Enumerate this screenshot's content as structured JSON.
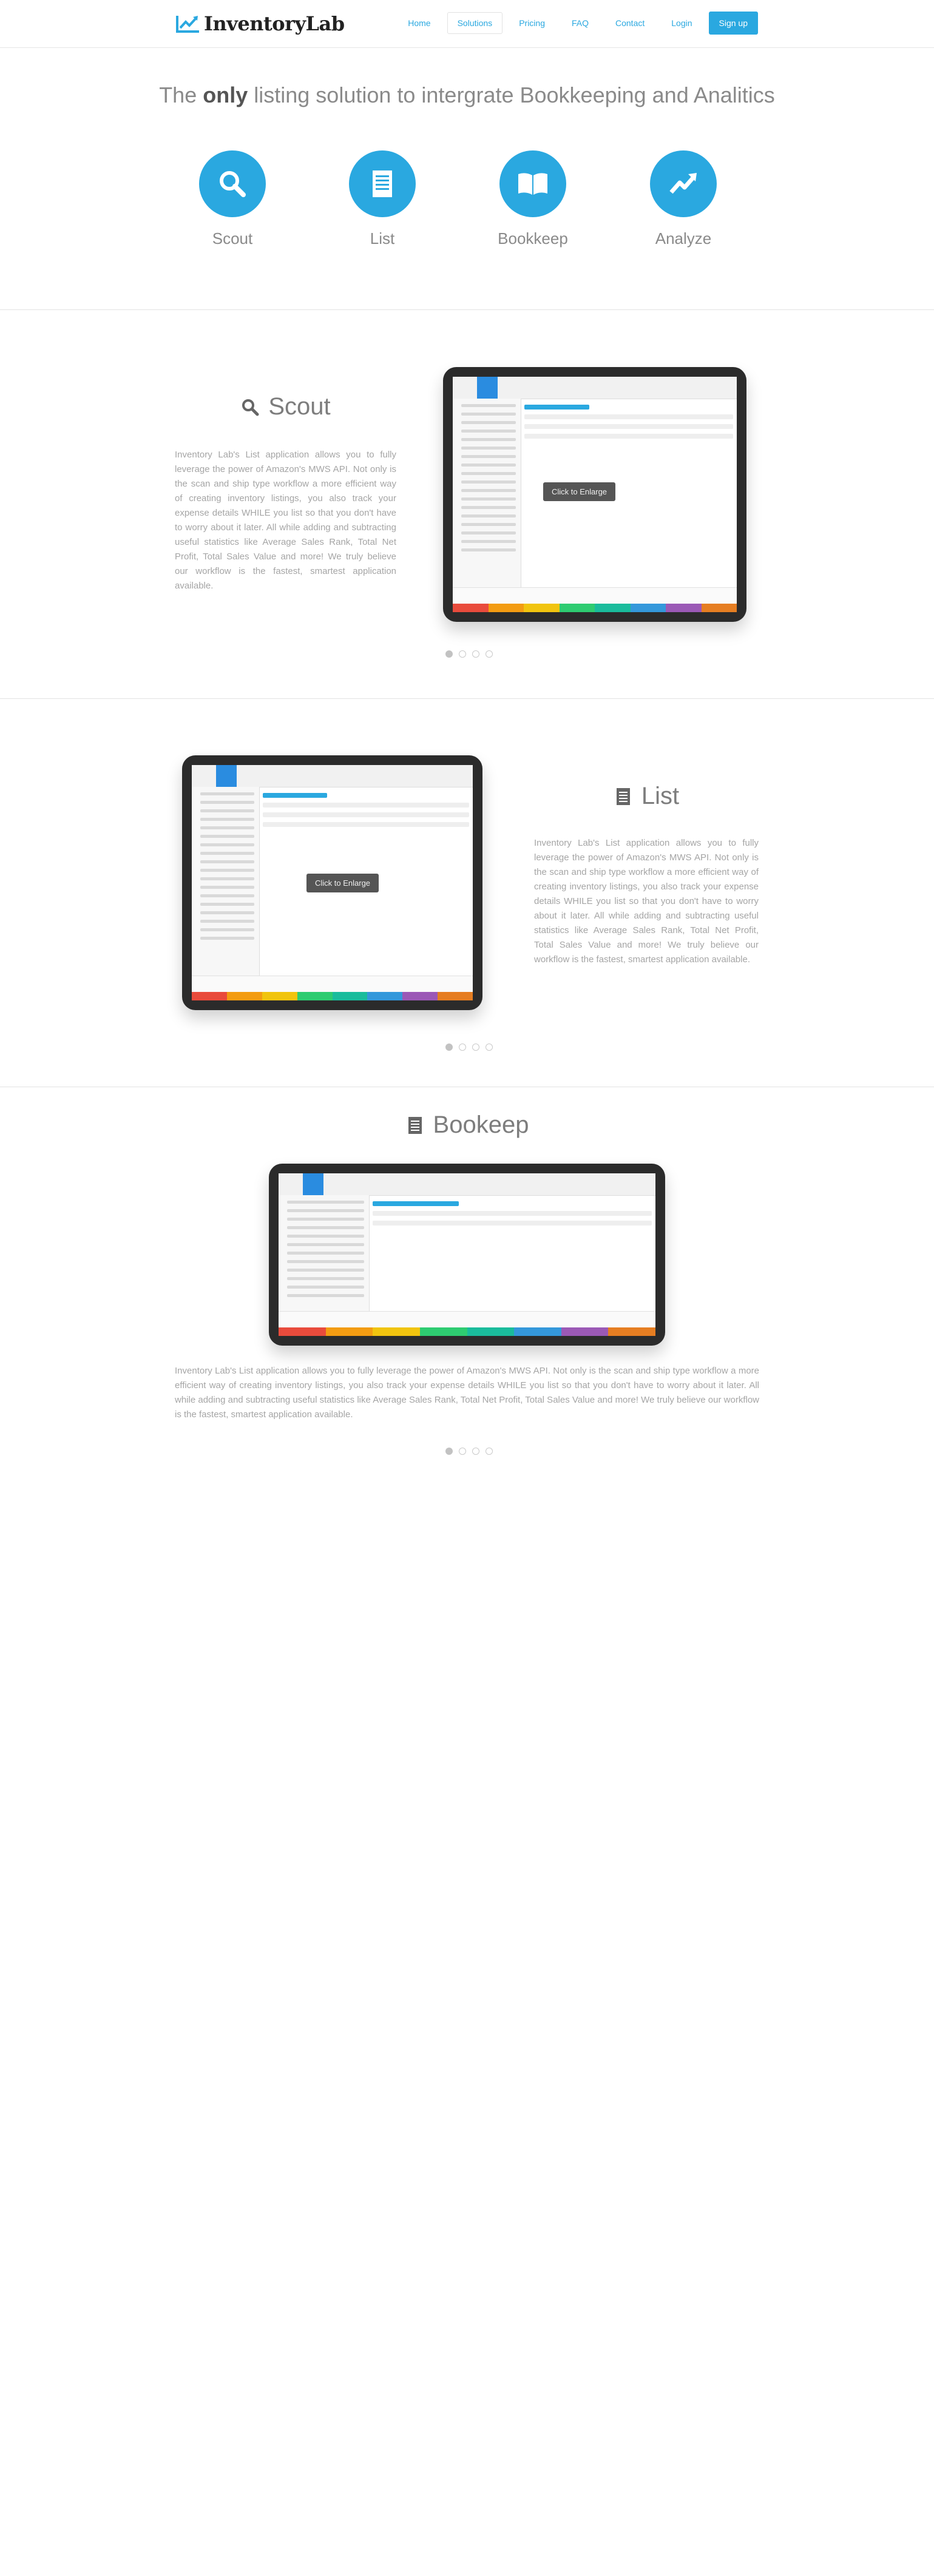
{
  "nav": {
    "logo_text": "InventoryLab",
    "items": [
      {
        "label": "Home"
      },
      {
        "label": "Solutions"
      },
      {
        "label": "Pricing"
      },
      {
        "label": "FAQ"
      },
      {
        "label": "Contact"
      },
      {
        "label": "Login"
      }
    ],
    "signup_label": "Sign up"
  },
  "hero": {
    "title_pre": "The ",
    "title_bold": "only",
    "title_post": " listing solution to intergrate Bookkeeping and Analitics",
    "features": [
      {
        "label": "Scout",
        "icon": "search-icon"
      },
      {
        "label": "List",
        "icon": "list-document-icon"
      },
      {
        "label": "Bookkeep",
        "icon": "open-book-icon"
      },
      {
        "label": "Analyze",
        "icon": "trend-arrow-icon"
      }
    ]
  },
  "scout": {
    "heading": "Scout",
    "text": "Inventory Lab's List application allows you to fully leverage the power of Amazon's MWS API. Not only is the scan and ship type workflow a more efficient way of creating inventory listings, you also track your expense details WHILE you list so that you don't have to worry about it later. All while adding and subtracting useful statistics like Average Sales Rank, Total Net Profit, Total Sales Value and more! We truly believe our workflow is the fastest, smartest application available.",
    "enlarge_label": "Click to Enlarge"
  },
  "list": {
    "heading": "List",
    "text": "Inventory Lab's List application allows you to fully leverage the power of Amazon's MWS API. Not only is the scan and ship type workflow a more efficient way of creating inventory listings, you also track your expense details WHILE you list so that you don't have to worry about it later. All while adding and subtracting useful statistics like Average Sales Rank, Total Net Profit, Total Sales Value and more! We truly believe our workflow is the fastest, smartest application available.",
    "enlarge_label": "Click to Enlarge"
  },
  "bookkeep": {
    "heading": "Bookeep",
    "text": "Inventory Lab's List application allows you to fully leverage the power of Amazon's MWS API. Not only is the scan and ship type workflow a more efficient way of creating inventory listings, you also track your expense details WHILE you list so that you don't have to worry about it later. All while adding and subtracting useful statistics like Average Sales Rank, Total Net Profit, Total Sales Value and more! We truly believe our workflow is the fastest, smartest application available."
  },
  "colors": {
    "accent": "#2aa8e0",
    "text": "#8a8a8a"
  }
}
